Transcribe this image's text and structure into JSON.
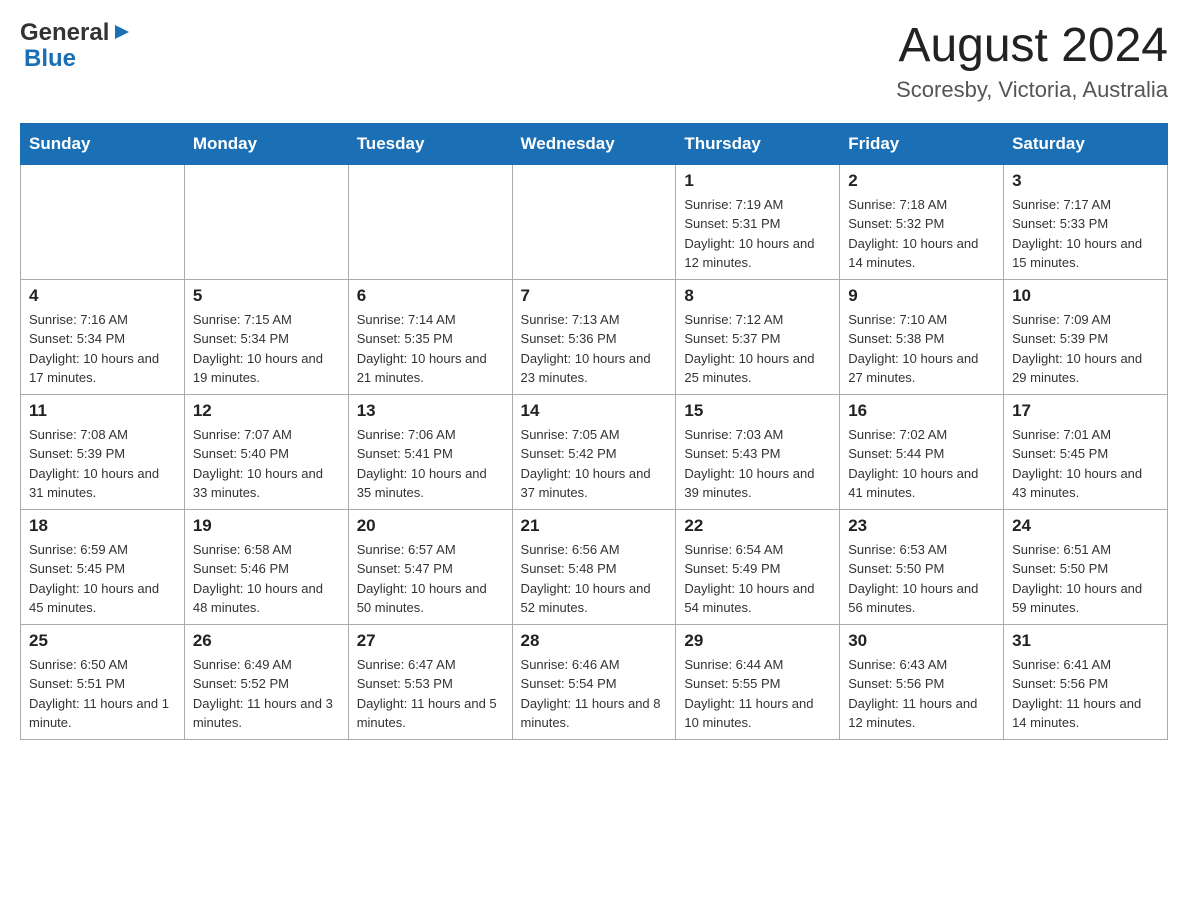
{
  "header": {
    "logo": {
      "general": "General",
      "arrow": "▶",
      "blue": "Blue"
    },
    "title": "August 2024",
    "location": "Scoresby, Victoria, Australia"
  },
  "weekdays": [
    "Sunday",
    "Monday",
    "Tuesday",
    "Wednesday",
    "Thursday",
    "Friday",
    "Saturday"
  ],
  "weeks": [
    [
      {
        "day": "",
        "sunrise": "",
        "sunset": "",
        "daylight": ""
      },
      {
        "day": "",
        "sunrise": "",
        "sunset": "",
        "daylight": ""
      },
      {
        "day": "",
        "sunrise": "",
        "sunset": "",
        "daylight": ""
      },
      {
        "day": "",
        "sunrise": "",
        "sunset": "",
        "daylight": ""
      },
      {
        "day": "1",
        "sunrise": "Sunrise: 7:19 AM",
        "sunset": "Sunset: 5:31 PM",
        "daylight": "Daylight: 10 hours and 12 minutes."
      },
      {
        "day": "2",
        "sunrise": "Sunrise: 7:18 AM",
        "sunset": "Sunset: 5:32 PM",
        "daylight": "Daylight: 10 hours and 14 minutes."
      },
      {
        "day": "3",
        "sunrise": "Sunrise: 7:17 AM",
        "sunset": "Sunset: 5:33 PM",
        "daylight": "Daylight: 10 hours and 15 minutes."
      }
    ],
    [
      {
        "day": "4",
        "sunrise": "Sunrise: 7:16 AM",
        "sunset": "Sunset: 5:34 PM",
        "daylight": "Daylight: 10 hours and 17 minutes."
      },
      {
        "day": "5",
        "sunrise": "Sunrise: 7:15 AM",
        "sunset": "Sunset: 5:34 PM",
        "daylight": "Daylight: 10 hours and 19 minutes."
      },
      {
        "day": "6",
        "sunrise": "Sunrise: 7:14 AM",
        "sunset": "Sunset: 5:35 PM",
        "daylight": "Daylight: 10 hours and 21 minutes."
      },
      {
        "day": "7",
        "sunrise": "Sunrise: 7:13 AM",
        "sunset": "Sunset: 5:36 PM",
        "daylight": "Daylight: 10 hours and 23 minutes."
      },
      {
        "day": "8",
        "sunrise": "Sunrise: 7:12 AM",
        "sunset": "Sunset: 5:37 PM",
        "daylight": "Daylight: 10 hours and 25 minutes."
      },
      {
        "day": "9",
        "sunrise": "Sunrise: 7:10 AM",
        "sunset": "Sunset: 5:38 PM",
        "daylight": "Daylight: 10 hours and 27 minutes."
      },
      {
        "day": "10",
        "sunrise": "Sunrise: 7:09 AM",
        "sunset": "Sunset: 5:39 PM",
        "daylight": "Daylight: 10 hours and 29 minutes."
      }
    ],
    [
      {
        "day": "11",
        "sunrise": "Sunrise: 7:08 AM",
        "sunset": "Sunset: 5:39 PM",
        "daylight": "Daylight: 10 hours and 31 minutes."
      },
      {
        "day": "12",
        "sunrise": "Sunrise: 7:07 AM",
        "sunset": "Sunset: 5:40 PM",
        "daylight": "Daylight: 10 hours and 33 minutes."
      },
      {
        "day": "13",
        "sunrise": "Sunrise: 7:06 AM",
        "sunset": "Sunset: 5:41 PM",
        "daylight": "Daylight: 10 hours and 35 minutes."
      },
      {
        "day": "14",
        "sunrise": "Sunrise: 7:05 AM",
        "sunset": "Sunset: 5:42 PM",
        "daylight": "Daylight: 10 hours and 37 minutes."
      },
      {
        "day": "15",
        "sunrise": "Sunrise: 7:03 AM",
        "sunset": "Sunset: 5:43 PM",
        "daylight": "Daylight: 10 hours and 39 minutes."
      },
      {
        "day": "16",
        "sunrise": "Sunrise: 7:02 AM",
        "sunset": "Sunset: 5:44 PM",
        "daylight": "Daylight: 10 hours and 41 minutes."
      },
      {
        "day": "17",
        "sunrise": "Sunrise: 7:01 AM",
        "sunset": "Sunset: 5:45 PM",
        "daylight": "Daylight: 10 hours and 43 minutes."
      }
    ],
    [
      {
        "day": "18",
        "sunrise": "Sunrise: 6:59 AM",
        "sunset": "Sunset: 5:45 PM",
        "daylight": "Daylight: 10 hours and 45 minutes."
      },
      {
        "day": "19",
        "sunrise": "Sunrise: 6:58 AM",
        "sunset": "Sunset: 5:46 PM",
        "daylight": "Daylight: 10 hours and 48 minutes."
      },
      {
        "day": "20",
        "sunrise": "Sunrise: 6:57 AM",
        "sunset": "Sunset: 5:47 PM",
        "daylight": "Daylight: 10 hours and 50 minutes."
      },
      {
        "day": "21",
        "sunrise": "Sunrise: 6:56 AM",
        "sunset": "Sunset: 5:48 PM",
        "daylight": "Daylight: 10 hours and 52 minutes."
      },
      {
        "day": "22",
        "sunrise": "Sunrise: 6:54 AM",
        "sunset": "Sunset: 5:49 PM",
        "daylight": "Daylight: 10 hours and 54 minutes."
      },
      {
        "day": "23",
        "sunrise": "Sunrise: 6:53 AM",
        "sunset": "Sunset: 5:50 PM",
        "daylight": "Daylight: 10 hours and 56 minutes."
      },
      {
        "day": "24",
        "sunrise": "Sunrise: 6:51 AM",
        "sunset": "Sunset: 5:50 PM",
        "daylight": "Daylight: 10 hours and 59 minutes."
      }
    ],
    [
      {
        "day": "25",
        "sunrise": "Sunrise: 6:50 AM",
        "sunset": "Sunset: 5:51 PM",
        "daylight": "Daylight: 11 hours and 1 minute."
      },
      {
        "day": "26",
        "sunrise": "Sunrise: 6:49 AM",
        "sunset": "Sunset: 5:52 PM",
        "daylight": "Daylight: 11 hours and 3 minutes."
      },
      {
        "day": "27",
        "sunrise": "Sunrise: 6:47 AM",
        "sunset": "Sunset: 5:53 PM",
        "daylight": "Daylight: 11 hours and 5 minutes."
      },
      {
        "day": "28",
        "sunrise": "Sunrise: 6:46 AM",
        "sunset": "Sunset: 5:54 PM",
        "daylight": "Daylight: 11 hours and 8 minutes."
      },
      {
        "day": "29",
        "sunrise": "Sunrise: 6:44 AM",
        "sunset": "Sunset: 5:55 PM",
        "daylight": "Daylight: 11 hours and 10 minutes."
      },
      {
        "day": "30",
        "sunrise": "Sunrise: 6:43 AM",
        "sunset": "Sunset: 5:56 PM",
        "daylight": "Daylight: 11 hours and 12 minutes."
      },
      {
        "day": "31",
        "sunrise": "Sunrise: 6:41 AM",
        "sunset": "Sunset: 5:56 PM",
        "daylight": "Daylight: 11 hours and 14 minutes."
      }
    ]
  ]
}
